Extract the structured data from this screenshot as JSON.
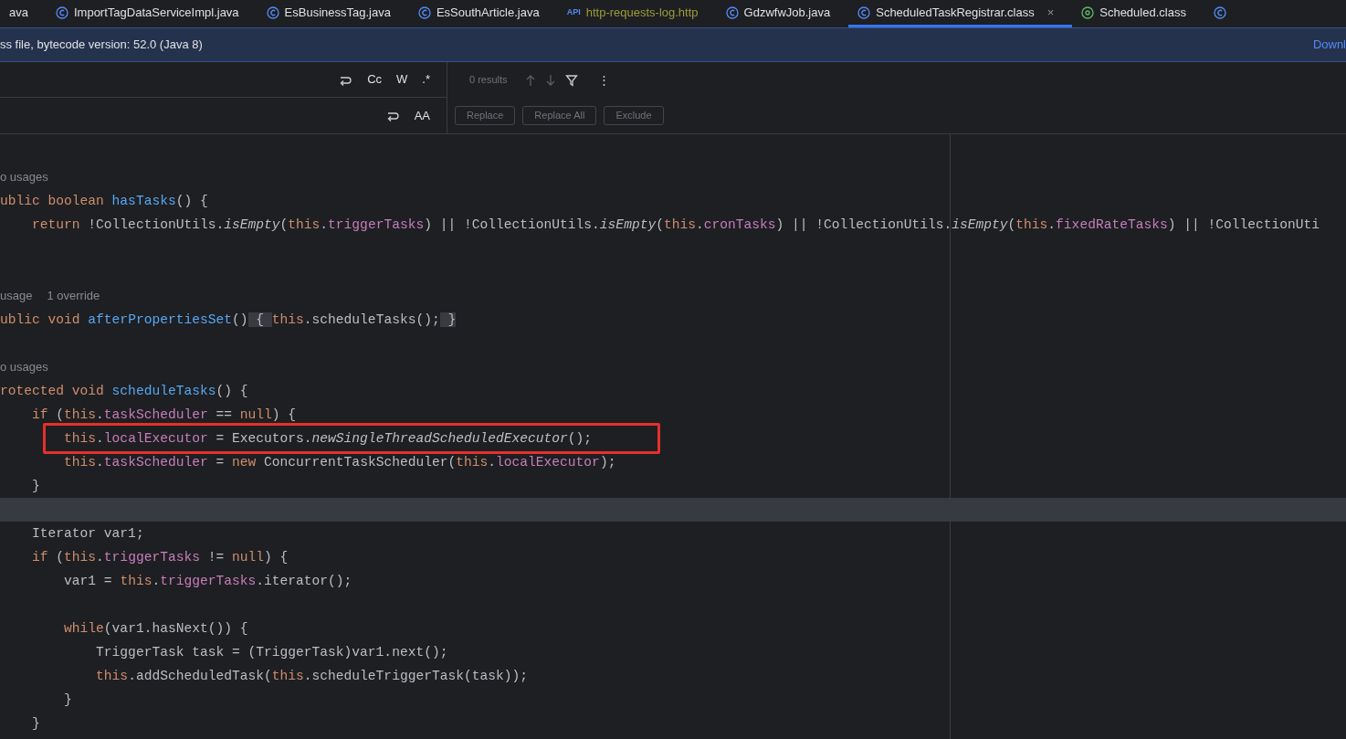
{
  "tabs": [
    {
      "label": "ava",
      "kind": "plain",
      "selected": false,
      "closable": false
    },
    {
      "label": "ImportTagDataServiceImpl.java",
      "kind": "class",
      "selected": false,
      "closable": false
    },
    {
      "label": "EsBusinessTag.java",
      "kind": "class",
      "selected": false,
      "closable": false
    },
    {
      "label": "EsSouthArticle.java",
      "kind": "class",
      "selected": false,
      "closable": false
    },
    {
      "label": "http-requests-log.http",
      "kind": "api",
      "badge": "API",
      "selected": false,
      "closable": false
    },
    {
      "label": "GdzwfwJob.java",
      "kind": "class",
      "selected": false,
      "closable": false
    },
    {
      "label": "ScheduledTaskRegistrar.class",
      "kind": "class",
      "selected": true,
      "closable": true,
      "close": "×"
    },
    {
      "label": "Scheduled.class",
      "kind": "annotation",
      "selected": false,
      "closable": false
    },
    {
      "kind": "class",
      "selected": false,
      "closable": false
    }
  ],
  "banner": {
    "text": "ss file, bytecode version: 52.0 (Java 8)",
    "link": "Downl"
  },
  "find": {
    "toggles": [
      "Cc",
      "W",
      ".*"
    ],
    "preserve_case": "AA",
    "results": "0 results",
    "menu": "⋮",
    "buttons": [
      {
        "label": "Replace",
        "disabled": true
      },
      {
        "label": "Replace All",
        "disabled": true
      },
      {
        "label": "Exclude",
        "disabled": true
      }
    ]
  },
  "lines": [
    {
      "kind": "hint",
      "texts": [
        "o usages"
      ],
      "current": false,
      "boxed": false
    },
    {
      "kind": "code",
      "tokens": [
        {
          "kind": "kw",
          "text": "ublic boolean "
        },
        {
          "kind": "fn",
          "text": "hasTasks"
        },
        {
          "kind": "pl",
          "text": "() {"
        }
      ],
      "current": false,
      "boxed": false
    },
    {
      "kind": "code",
      "tokens": [
        {
          "kind": "kw",
          "text": "    return"
        },
        {
          "kind": "pl",
          "text": " !CollectionUtils."
        },
        {
          "kind": "it",
          "text": "isEmpty"
        },
        {
          "kind": "pl",
          "text": "("
        },
        {
          "kind": "kw",
          "text": "this"
        },
        {
          "kind": "pl",
          "text": "."
        },
        {
          "kind": "fld",
          "text": "triggerTasks"
        },
        {
          "kind": "pl",
          "text": ") || !CollectionUtils."
        },
        {
          "kind": "it",
          "text": "isEmpty"
        },
        {
          "kind": "pl",
          "text": "("
        },
        {
          "kind": "kw",
          "text": "this"
        },
        {
          "kind": "pl",
          "text": "."
        },
        {
          "kind": "fld",
          "text": "cronTasks"
        },
        {
          "kind": "pl",
          "text": ") || !CollectionUtils."
        },
        {
          "kind": "it",
          "text": "isEmpty"
        },
        {
          "kind": "pl",
          "text": "("
        },
        {
          "kind": "kw",
          "text": "this"
        },
        {
          "kind": "pl",
          "text": "."
        },
        {
          "kind": "fld",
          "text": "fixedRateTasks"
        },
        {
          "kind": "pl",
          "text": ") || !CollectionUti"
        }
      ],
      "current": false,
      "boxed": false
    },
    {
      "kind": "blank",
      "current": false,
      "boxed": false
    },
    {
      "kind": "blank",
      "current": false,
      "boxed": false
    },
    {
      "kind": "hint",
      "texts": [
        "usage",
        "1 override"
      ],
      "current": false,
      "boxed": false
    },
    {
      "kind": "code",
      "tokens": [
        {
          "kind": "kw",
          "text": "ublic void "
        },
        {
          "kind": "fn",
          "text": "afterPropertiesSet"
        },
        {
          "kind": "pl",
          "text": "()"
        },
        {
          "kind": "fold",
          "text": " { "
        },
        {
          "kind": "kw",
          "text": "this"
        },
        {
          "kind": "pl",
          "text": ".scheduleTasks();"
        },
        {
          "kind": "fold",
          "text": " }"
        }
      ],
      "current": false,
      "boxed": false
    },
    {
      "kind": "blank",
      "current": false,
      "boxed": false
    },
    {
      "kind": "hint",
      "texts": [
        "o usages"
      ],
      "current": false,
      "boxed": false
    },
    {
      "kind": "code",
      "tokens": [
        {
          "kind": "kw",
          "text": "rotected void "
        },
        {
          "kind": "fn",
          "text": "scheduleTasks"
        },
        {
          "kind": "pl",
          "text": "() {"
        }
      ],
      "current": false,
      "boxed": false
    },
    {
      "kind": "code",
      "tokens": [
        {
          "kind": "kw",
          "text": "    if"
        },
        {
          "kind": "pl",
          "text": " ("
        },
        {
          "kind": "kw",
          "text": "this"
        },
        {
          "kind": "pl",
          "text": "."
        },
        {
          "kind": "fld",
          "text": "taskScheduler"
        },
        {
          "kind": "pl",
          "text": " == "
        },
        {
          "kind": "kw",
          "text": "null"
        },
        {
          "kind": "pl",
          "text": ") {"
        }
      ],
      "current": false,
      "boxed": false
    },
    {
      "kind": "code",
      "tokens": [
        {
          "kind": "kw",
          "text": "        this"
        },
        {
          "kind": "pl",
          "text": "."
        },
        {
          "kind": "fld",
          "text": "localExecutor"
        },
        {
          "kind": "pl",
          "text": " = Executors."
        },
        {
          "kind": "it",
          "text": "newSingleThreadScheduledExecutor"
        },
        {
          "kind": "pl",
          "text": "();"
        }
      ],
      "current": false,
      "boxed": true
    },
    {
      "kind": "code",
      "tokens": [
        {
          "kind": "kw",
          "text": "        this"
        },
        {
          "kind": "pl",
          "text": "."
        },
        {
          "kind": "fld",
          "text": "taskScheduler"
        },
        {
          "kind": "pl",
          "text": " = "
        },
        {
          "kind": "kw",
          "text": "new"
        },
        {
          "kind": "pl",
          "text": " ConcurrentTaskScheduler("
        },
        {
          "kind": "kw",
          "text": "this"
        },
        {
          "kind": "pl",
          "text": "."
        },
        {
          "kind": "fld",
          "text": "localExecutor"
        },
        {
          "kind": "pl",
          "text": ");"
        }
      ],
      "current": false,
      "boxed": false
    },
    {
      "kind": "code",
      "tokens": [
        {
          "kind": "pl",
          "text": "    }"
        }
      ],
      "current": false,
      "boxed": false
    },
    {
      "kind": "blank",
      "current": true,
      "boxed": false
    },
    {
      "kind": "code",
      "tokens": [
        {
          "kind": "pl",
          "text": "    Iterator var1;"
        }
      ],
      "current": false,
      "boxed": false
    },
    {
      "kind": "code",
      "tokens": [
        {
          "kind": "kw",
          "text": "    if"
        },
        {
          "kind": "pl",
          "text": " ("
        },
        {
          "kind": "kw",
          "text": "this"
        },
        {
          "kind": "pl",
          "text": "."
        },
        {
          "kind": "fld",
          "text": "triggerTasks"
        },
        {
          "kind": "pl",
          "text": " != "
        },
        {
          "kind": "kw",
          "text": "null"
        },
        {
          "kind": "pl",
          "text": ") {"
        }
      ],
      "current": false,
      "boxed": false
    },
    {
      "kind": "code",
      "tokens": [
        {
          "kind": "pl",
          "text": "        var1 = "
        },
        {
          "kind": "kw",
          "text": "this"
        },
        {
          "kind": "pl",
          "text": "."
        },
        {
          "kind": "fld",
          "text": "triggerTasks"
        },
        {
          "kind": "pl",
          "text": ".iterator();"
        }
      ],
      "current": false,
      "boxed": false
    },
    {
      "kind": "blank",
      "current": false,
      "boxed": false
    },
    {
      "kind": "code",
      "tokens": [
        {
          "kind": "kw",
          "text": "        while"
        },
        {
          "kind": "pl",
          "text": "(var1.hasNext()) {"
        }
      ],
      "current": false,
      "boxed": false
    },
    {
      "kind": "code",
      "tokens": [
        {
          "kind": "pl",
          "text": "            TriggerTask task = (TriggerTask)var1.next();"
        }
      ],
      "current": false,
      "boxed": false
    },
    {
      "kind": "code",
      "tokens": [
        {
          "kind": "kw",
          "text": "            this"
        },
        {
          "kind": "pl",
          "text": ".addScheduledTask("
        },
        {
          "kind": "kw",
          "text": "this"
        },
        {
          "kind": "pl",
          "text": ".scheduleTriggerTask(task));"
        }
      ],
      "current": false,
      "boxed": false
    },
    {
      "kind": "code",
      "tokens": [
        {
          "kind": "pl",
          "text": "        }"
        }
      ],
      "current": false,
      "boxed": false
    },
    {
      "kind": "code",
      "tokens": [
        {
          "kind": "pl",
          "text": "    }"
        }
      ],
      "current": false,
      "boxed": false
    }
  ]
}
